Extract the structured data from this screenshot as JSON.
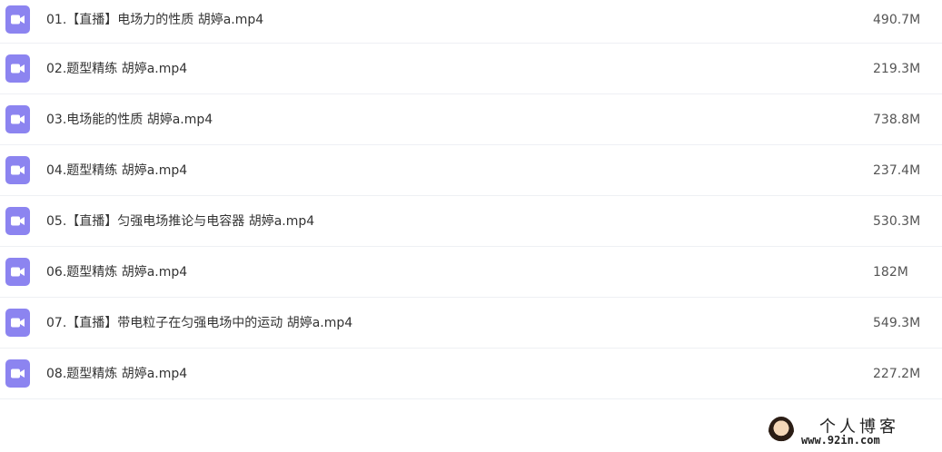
{
  "files": [
    {
      "name": "01.【直播】电场力的性质 胡婷a.mp4",
      "size": "490.7M",
      "icon": "video-file-icon"
    },
    {
      "name": "02.题型精练 胡婷a.mp4",
      "size": "219.3M",
      "icon": "video-file-icon"
    },
    {
      "name": "03.电场能的性质 胡婷a.mp4",
      "size": "738.8M",
      "icon": "video-file-icon"
    },
    {
      "name": "04.题型精练 胡婷a.mp4",
      "size": "237.4M",
      "icon": "video-file-icon"
    },
    {
      "name": "05.【直播】匀强电场推论与电容器 胡婷a.mp4",
      "size": "530.3M",
      "icon": "video-file-icon"
    },
    {
      "name": "06.题型精炼 胡婷a.mp4",
      "size": "182M",
      "icon": "video-file-icon"
    },
    {
      "name": "07.【直播】带电粒子在匀强电场中的运动 胡婷a.mp4",
      "size": "549.3M",
      "icon": "video-file-icon"
    },
    {
      "name": "08.题型精炼 胡婷a.mp4",
      "size": "227.2M",
      "icon": "video-file-icon"
    }
  ],
  "watermark": {
    "title": "个人博客",
    "url": "www.92in.com"
  },
  "colors": {
    "icon_bg": "#8c84f0",
    "text": "#333333",
    "divider": "#eef0f4"
  }
}
